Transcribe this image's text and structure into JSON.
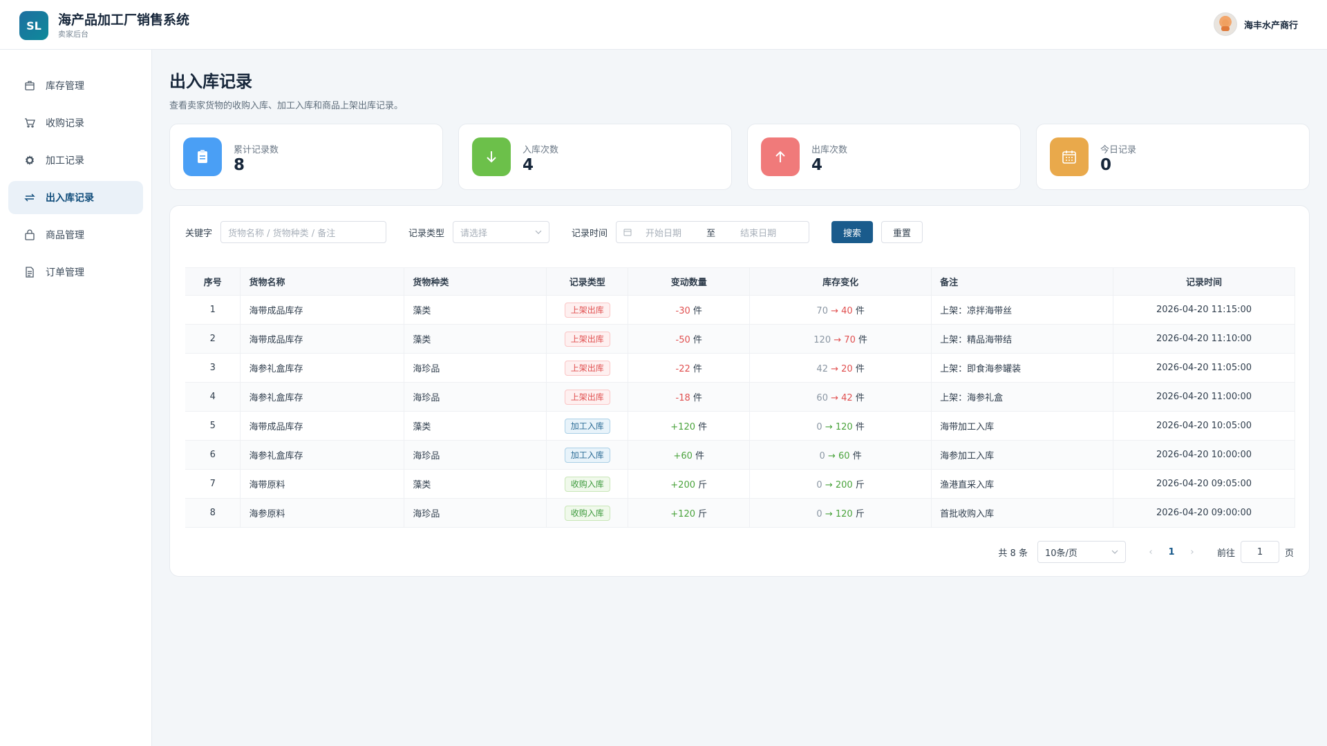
{
  "header": {
    "logo_text": "SL",
    "title": "海产品加工厂销售系统",
    "subtitle": "卖家后台",
    "user_name": "海丰水产商行"
  },
  "sidebar": {
    "items": [
      {
        "label": "库存管理",
        "icon": "box-icon"
      },
      {
        "label": "收购记录",
        "icon": "cart-icon"
      },
      {
        "label": "加工记录",
        "icon": "gear-icon"
      },
      {
        "label": "出入库记录",
        "icon": "swap-icon",
        "active": true
      },
      {
        "label": "商品管理",
        "icon": "bag-icon"
      },
      {
        "label": "订单管理",
        "icon": "document-icon"
      }
    ]
  },
  "page": {
    "title": "出入库记录",
    "description": "查看卖家货物的收购入库、加工入库和商品上架出库记录。"
  },
  "stats": [
    {
      "label": "累计记录数",
      "value": "8",
      "color": "#4a9ff5",
      "icon": "clipboard-icon"
    },
    {
      "label": "入库次数",
      "value": "4",
      "color": "#6cc04a",
      "icon": "arrow-down-icon"
    },
    {
      "label": "出库次数",
      "value": "4",
      "color": "#f07a7a",
      "icon": "arrow-up-icon"
    },
    {
      "label": "今日记录",
      "value": "0",
      "color": "#e9a94b",
      "icon": "calendar-icon"
    }
  ],
  "filters": {
    "keyword_label": "关键字",
    "keyword_placeholder": "货物名称 / 货物种类 / 备注",
    "type_label": "记录类型",
    "type_placeholder": "请选择",
    "time_label": "记录时间",
    "start_placeholder": "开始日期",
    "range_sep": "至",
    "end_placeholder": "结束日期",
    "search_btn": "搜索",
    "reset_btn": "重置"
  },
  "table": {
    "headers": [
      "序号",
      "货物名称",
      "货物种类",
      "记录类型",
      "变动数量",
      "库存变化",
      "备注",
      "记录时间"
    ],
    "rows": [
      {
        "no": "1",
        "name": "海带成品库存",
        "kind": "藻类",
        "type": "上架出库",
        "tag": "out",
        "qty": "-30",
        "unit": "件",
        "before": "70",
        "after": "40",
        "remark": "上架：凉拌海带丝",
        "time": "2026-04-20 11:15:00"
      },
      {
        "no": "2",
        "name": "海带成品库存",
        "kind": "藻类",
        "type": "上架出库",
        "tag": "out",
        "qty": "-50",
        "unit": "件",
        "before": "120",
        "after": "70",
        "remark": "上架：精品海带结",
        "time": "2026-04-20 11:10:00"
      },
      {
        "no": "3",
        "name": "海参礼盒库存",
        "kind": "海珍品",
        "type": "上架出库",
        "tag": "out",
        "qty": "-22",
        "unit": "件",
        "before": "42",
        "after": "20",
        "remark": "上架：即食海参罐装",
        "time": "2026-04-20 11:05:00"
      },
      {
        "no": "4",
        "name": "海参礼盒库存",
        "kind": "海珍品",
        "type": "上架出库",
        "tag": "out",
        "qty": "-18",
        "unit": "件",
        "before": "60",
        "after": "42",
        "remark": "上架：海参礼盒",
        "time": "2026-04-20 11:00:00"
      },
      {
        "no": "5",
        "name": "海带成品库存",
        "kind": "藻类",
        "type": "加工入库",
        "tag": "proc",
        "qty": "+120",
        "unit": "件",
        "before": "0",
        "after": "120",
        "remark": "海带加工入库",
        "time": "2026-04-20 10:05:00"
      },
      {
        "no": "6",
        "name": "海参礼盒库存",
        "kind": "海珍品",
        "type": "加工入库",
        "tag": "proc",
        "qty": "+60",
        "unit": "件",
        "before": "0",
        "after": "60",
        "remark": "海参加工入库",
        "time": "2026-04-20 10:00:00"
      },
      {
        "no": "7",
        "name": "海带原料",
        "kind": "藻类",
        "type": "收购入库",
        "tag": "buy",
        "qty": "+200",
        "unit": "斤",
        "before": "0",
        "after": "200",
        "remark": "渔港直采入库",
        "time": "2026-04-20 09:05:00"
      },
      {
        "no": "8",
        "name": "海参原料",
        "kind": "海珍品",
        "type": "收购入库",
        "tag": "buy",
        "qty": "+120",
        "unit": "斤",
        "before": "0",
        "after": "120",
        "remark": "首批收购入库",
        "time": "2026-04-20 09:00:00"
      }
    ]
  },
  "pagination": {
    "total": "共 8 条",
    "page_size": "10条/页",
    "current": "1",
    "goto_label": "前往",
    "goto_value": "1",
    "page_suffix": "页"
  }
}
